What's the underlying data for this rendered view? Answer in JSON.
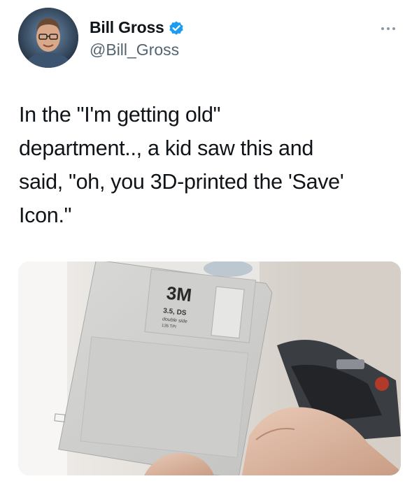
{
  "author": {
    "display_name": "Bill Gross",
    "handle": "@Bill_Gross",
    "verified": true,
    "avatar_icon": "profile-photo"
  },
  "menu": {
    "icon": "more-horizontal-icon"
  },
  "tweet": {
    "text": "In the \"I'm getting old\"\ndepartment.., a kid saw this and\nsaid, \"oh, you 3D-printed the 'Save'\nIcon.\""
  },
  "media": {
    "description_icon": "floppy-disk-photo",
    "disk_label": {
      "brand": "3M",
      "format": "3.5, DS",
      "density": "double side",
      "tpi": "135 TPI"
    }
  },
  "colors": {
    "verified_blue": "#1d9bf0",
    "text": "#0f1419",
    "secondary_text": "#536471"
  }
}
